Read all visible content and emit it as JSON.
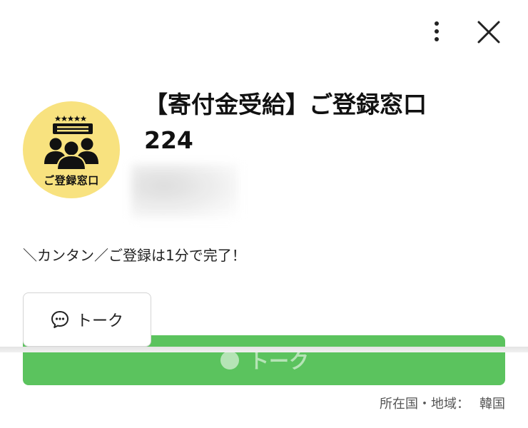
{
  "header": {
    "more_icon": "vertical-dots-icon",
    "close_icon": "close-icon"
  },
  "profile": {
    "avatar_label": "ご登録窓口",
    "name": "【寄付金受給】ご登録窓口\n224",
    "description": "＼カンタン／ご登録は1分で完了！"
  },
  "actions": {
    "talk_label": "トーク",
    "talk_icon": "chat-bubble-icon",
    "primary_label": "トーク",
    "primary_color": "#5bc35e"
  },
  "footer": {
    "country_label": "所在国・地域：",
    "country_value": "韓国"
  }
}
